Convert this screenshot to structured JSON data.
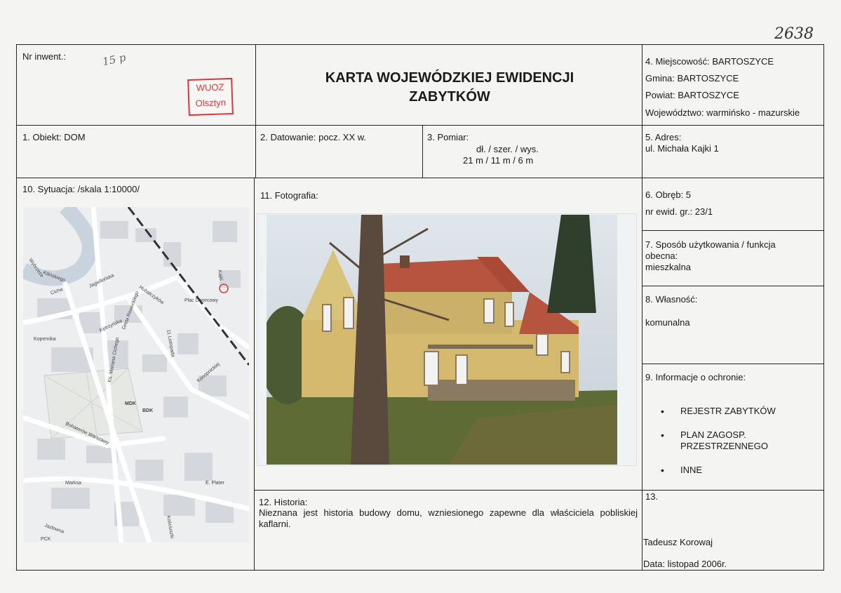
{
  "top_handwritten_number": "2638",
  "header": {
    "inv_label": "Nr inwent.:",
    "inv_handwritten": "15 p",
    "stamp_line1": "WUOZ",
    "stamp_line2": "Olsztyn",
    "title_line1": "KARTA WOJEWÓDZKIEJ EWIDENCJI",
    "title_line2": "ZABYTKÓW",
    "location": {
      "miejscowosc": "4. Miejscowość: BARTOSZYCE",
      "gmina": "Gmina: BARTOSZYCE",
      "powiat": "Powiat: BARTOSZYCE",
      "wojewodztwo": "Województwo: warmińsko - mazurskie"
    }
  },
  "row2": {
    "obiekt": "1. Obiekt: DOM",
    "datowanie": "2. Datowanie: pocz. XX w.",
    "pomiar_label": "3. Pomiar:",
    "pomiar_dims": "dł. / szer. / wys.",
    "pomiar_values": "21 m / 11 m / 6 m",
    "adres_label": "5. Adres:",
    "adres_value": "ul. Michała Kajki 1"
  },
  "sytuacja": {
    "label": "10. Sytuacja: /skala 1:10000/",
    "map_labels": [
      "Wybrzeże",
      "Kilińskiego",
      "Cicha",
      "Jagiellońska",
      "Hubalczyków",
      "Kajki",
      "Plac Dworcowy",
      "Kętrzyńska",
      "Kopernika",
      "Grota Roweckiego",
      "Ks. Mariana Cichego",
      "Bohaterów Warszawy",
      "Konopnickiej",
      "MDK",
      "BDK",
      "Marksa",
      "Jazłowna",
      "PCK",
      "E. Plater",
      "Kościuszki",
      "11 Listopada"
    ]
  },
  "fotografia": {
    "label": "11. Fotografia:"
  },
  "obreb": {
    "obreb": "6. Obręb: 5",
    "nr_ewid": "nr ewid. gr.: 23/1"
  },
  "uzytkowanie": {
    "line1": "7. Sposób użytkowania / funkcja",
    "line2": "obecna:",
    "value": "mieszkalna"
  },
  "wlasnosc": {
    "label": "8. Własność:",
    "value": "komunalna"
  },
  "ochrona": {
    "label": "9. Informacje o ochronie:",
    "items": [
      "REJESTR ZABYTKÓW",
      "PLAN ZAGOSP.",
      "PRZESTRZENNEGO",
      "INNE"
    ]
  },
  "historia": {
    "label": "12. Historia:",
    "text": "Nieznana jest historia budowy domu, wzniesionego zapewne dla właściciela pobliskiej kaflarni."
  },
  "autor": {
    "label": "13.",
    "name": "Tadeusz Korowaj",
    "date": "Data: listopad 2006r."
  }
}
